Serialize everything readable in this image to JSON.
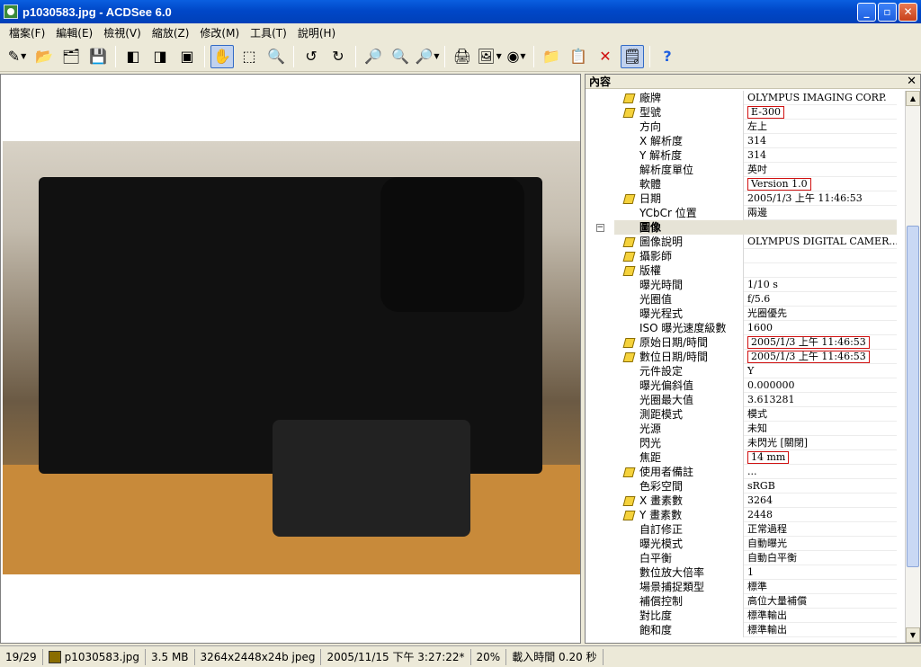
{
  "window": {
    "title": "p1030583.jpg - ACDSee 6.0",
    "minimize": "_",
    "restore": "▫",
    "close": "✕"
  },
  "menu": [
    "檔案(F)",
    "編輯(E)",
    "檢視(V)",
    "縮放(Z)",
    "修改(M)",
    "工具(T)",
    "說明(H)"
  ],
  "toolbar": {
    "icons": [
      "acquire-icon",
      "open-folder-icon",
      "browse-icon",
      "save-icon",
      "prev-image-icon",
      "next-image-icon",
      "auto-advance-icon",
      "hand-icon",
      "select-icon",
      "magnify-icon",
      "rotate-left-icon",
      "rotate-right-icon",
      "zoom-out-icon",
      "zoom-in-icon",
      "zoom-icon",
      "print-icon",
      "wallpaper-icon",
      "sound-icon",
      "copy-to-icon",
      "move-to-icon",
      "delete-icon",
      "properties-icon",
      "help-icon"
    ]
  },
  "properties": {
    "header": "內容",
    "close": "✕",
    "rows": [
      {
        "name": "廠牌",
        "value": "OLYMPUS IMAGING CORP.",
        "pen": true,
        "highlight": false
      },
      {
        "name": "型號",
        "value": "E-300",
        "pen": true,
        "highlight": true
      },
      {
        "name": "方向",
        "value": "左上",
        "pen": false,
        "highlight": false
      },
      {
        "name": "X 解析度",
        "value": "314",
        "pen": false,
        "highlight": false
      },
      {
        "name": "Y 解析度",
        "value": "314",
        "pen": false,
        "highlight": false
      },
      {
        "name": "解析度單位",
        "value": "英吋",
        "pen": false,
        "highlight": false
      },
      {
        "name": "軟體",
        "value": "Version 1.0",
        "pen": false,
        "highlight": true
      },
      {
        "name": "日期",
        "value": "2005/1/3 上午 11:46:53",
        "pen": true,
        "highlight": false
      },
      {
        "name": "YCbCr 位置",
        "value": "兩邊",
        "pen": false,
        "highlight": false
      },
      {
        "name": "圖像",
        "value": "",
        "group": true
      },
      {
        "name": "圖像說明",
        "value": "OLYMPUS DIGITAL CAMER...",
        "pen": true,
        "highlight": false
      },
      {
        "name": "攝影師",
        "value": "",
        "pen": true,
        "highlight": false
      },
      {
        "name": "版權",
        "value": "",
        "pen": true,
        "highlight": false
      },
      {
        "name": "曝光時間",
        "value": "1/10 s",
        "pen": false,
        "highlight": false
      },
      {
        "name": "光圈值",
        "value": "f/5.6",
        "pen": false,
        "highlight": false
      },
      {
        "name": "曝光程式",
        "value": "光圈優先",
        "pen": false,
        "highlight": false
      },
      {
        "name": "ISO 曝光速度級數",
        "value": "1600",
        "pen": false,
        "highlight": false
      },
      {
        "name": "原始日期/時間",
        "value": "2005/1/3 上午 11:46:53",
        "pen": true,
        "highlight": true
      },
      {
        "name": "數位日期/時間",
        "value": "2005/1/3 上午 11:46:53",
        "pen": true,
        "highlight": true
      },
      {
        "name": "元件設定",
        "value": "Y",
        "pen": false,
        "highlight": false
      },
      {
        "name": "曝光偏斜值",
        "value": "0.000000",
        "pen": false,
        "highlight": false
      },
      {
        "name": "光圈最大值",
        "value": "3.613281",
        "pen": false,
        "highlight": false
      },
      {
        "name": "測距模式",
        "value": "模式",
        "pen": false,
        "highlight": false
      },
      {
        "name": "光源",
        "value": "未知",
        "pen": false,
        "highlight": false
      },
      {
        "name": "閃光",
        "value": "未閃光 [關閉]",
        "pen": false,
        "highlight": false
      },
      {
        "name": "焦距",
        "value": "14 mm",
        "pen": false,
        "highlight": true
      },
      {
        "name": "使用者備註",
        "value": "...",
        "pen": true,
        "highlight": false
      },
      {
        "name": "色彩空間",
        "value": "sRGB",
        "pen": false,
        "highlight": false
      },
      {
        "name": "X 畫素數",
        "value": "3264",
        "pen": true,
        "highlight": false
      },
      {
        "name": "Y 畫素數",
        "value": "2448",
        "pen": true,
        "highlight": false
      },
      {
        "name": "自訂修正",
        "value": "正常過程",
        "pen": false,
        "highlight": false
      },
      {
        "name": "曝光模式",
        "value": "自動曝光",
        "pen": false,
        "highlight": false
      },
      {
        "name": "白平衡",
        "value": "自動白平衡",
        "pen": false,
        "highlight": false
      },
      {
        "name": "數位放大倍率",
        "value": "1",
        "pen": false,
        "highlight": false
      },
      {
        "name": "場景捕捉類型",
        "value": "標準",
        "pen": false,
        "highlight": false
      },
      {
        "name": "補償控制",
        "value": "高位大量補償",
        "pen": false,
        "highlight": false
      },
      {
        "name": "對比度",
        "value": "標準輸出",
        "pen": false,
        "highlight": false
      },
      {
        "name": "飽和度",
        "value": "標準輸出",
        "pen": false,
        "highlight": false
      }
    ]
  },
  "status": {
    "index": "19/29",
    "filename": "p1030583.jpg",
    "size": "3.5 MB",
    "dimensions": "3264x2448x24b jpeg",
    "modified": "2005/11/15 下午 3:27:22*",
    "zoom": "20%",
    "load_time": "載入時間 0.20 秒"
  },
  "colors": {
    "titlebar": "#0047c8",
    "highlight_box": "#d01010",
    "chrome": "#ece9d8"
  }
}
